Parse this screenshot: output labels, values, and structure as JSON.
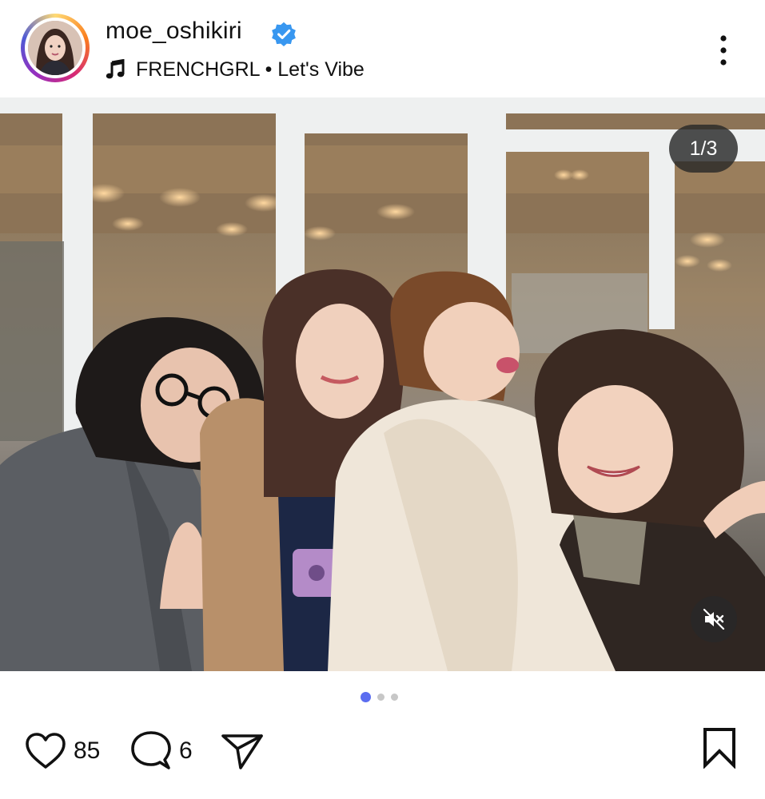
{
  "post": {
    "username": "moe_oshikiri",
    "verified": true,
    "music": {
      "icon": "music-note-icon",
      "track": "FRENCHGRL • Let's Vibe"
    },
    "more_icon": "more-vertical-icon"
  },
  "media": {
    "counter": "1/3",
    "mute_icon": "muted-speaker-icon",
    "carousel": {
      "total": 3,
      "active_index": 0
    }
  },
  "actions": {
    "likes": "85",
    "comments": "6",
    "like_icon": "heart-icon",
    "comment_icon": "comment-icon",
    "share_icon": "send-icon",
    "save_icon": "bookmark-icon"
  },
  "colors": {
    "verified_blue": "#3897f0",
    "active_dot": "#5b6df0",
    "inactive_dot": "#c7c7c7"
  }
}
